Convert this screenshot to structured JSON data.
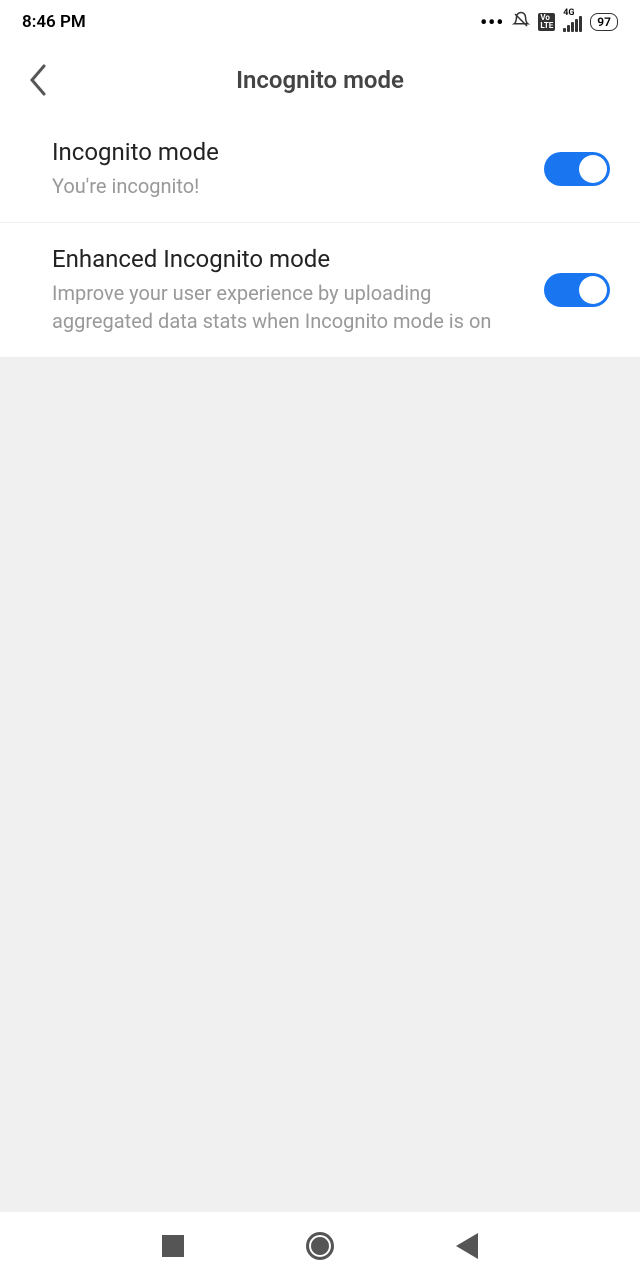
{
  "status": {
    "time": "8:46 PM",
    "network_type": "4G",
    "battery": "97"
  },
  "header": {
    "title": "Incognito mode"
  },
  "settings": [
    {
      "title": "Incognito mode",
      "subtitle": "You're incognito!",
      "enabled": true
    },
    {
      "title": "Enhanced Incognito mode",
      "subtitle": "Improve your user experience by uploading aggregated data stats when Incognito mode is on",
      "enabled": true
    }
  ]
}
